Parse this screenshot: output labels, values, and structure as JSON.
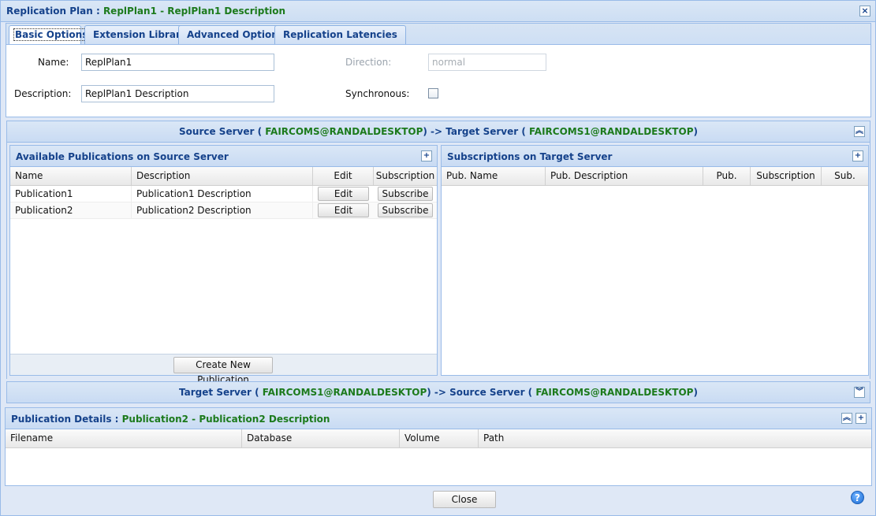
{
  "window": {
    "title_prefix": "Replication Plan : ",
    "title_detail": "ReplPlan1 - ReplPlan1 Description",
    "close_glyph": "×"
  },
  "tabs": [
    {
      "label": "Basic Options",
      "active": true
    },
    {
      "label": "Extension Library",
      "active": false
    },
    {
      "label": "Advanced Options",
      "active": false
    },
    {
      "label": "Replication Latencies",
      "active": false
    }
  ],
  "form": {
    "name_label": "Name:",
    "name_value": "ReplPlan1",
    "description_label": "Description:",
    "description_value": "ReplPlan1 Description",
    "direction_label": "Direction:",
    "direction_value": "normal",
    "synchronous_label": "Synchronous:",
    "synchronous_checked": false
  },
  "source_to_target": {
    "part1": "Source Server ( ",
    "source": "FAIRCOMS@RANDALDESKTOP",
    "part2": ") -> Target Server ( ",
    "target": "FAIRCOMS1@RANDALDESKTOP",
    "part3": ")",
    "collapse_glyph": "︽"
  },
  "available_publications": {
    "title": "Available Publications on Source Server",
    "add_glyph": "+",
    "columns": [
      "Name",
      "Description",
      "Edit",
      "Subscription"
    ],
    "rows": [
      {
        "name": "Publication1",
        "description": "Publication1 Description",
        "edit": "Edit",
        "subscribe": "Subscribe"
      },
      {
        "name": "Publication2",
        "description": "Publication2 Description",
        "edit": "Edit",
        "subscribe": "Subscribe"
      }
    ],
    "create_button": "Create New Publication"
  },
  "subscriptions": {
    "title": "Subscriptions on Target Server",
    "add_glyph": "+",
    "columns": [
      "Pub. Name",
      "Pub. Description",
      "Pub.",
      "Subscription",
      "Sub."
    ]
  },
  "target_to_source": {
    "part1": "Target Server ( ",
    "target": "FAIRCOMS1@RANDALDESKTOP",
    "part2": ") -> Source Server ( ",
    "source": "FAIRCOMS@RANDALDESKTOP",
    "part3": ")",
    "expand_glyph": "︾"
  },
  "publication_details": {
    "prefix": "Publication Details : ",
    "detail": "Publication2 - Publication2 Description",
    "collapse_glyph": "︽",
    "add_glyph": "+",
    "columns": [
      "Filename",
      "Database",
      "Volume",
      "Path"
    ]
  },
  "footer": {
    "close_button": "Close",
    "help_glyph": "?"
  },
  "colors": {
    "header_blue": "#15428b",
    "accent_green": "#1c7a1c",
    "panel_bg": "#dfe8f6",
    "border": "#99bbe8"
  }
}
